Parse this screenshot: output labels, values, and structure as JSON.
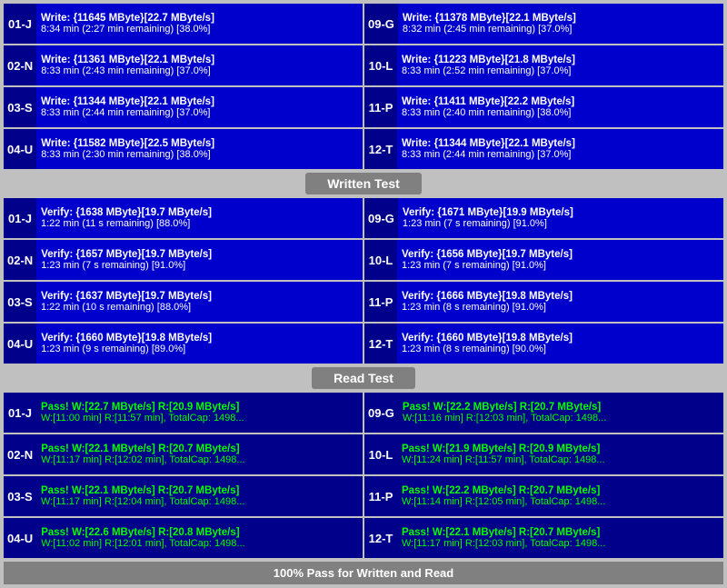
{
  "sections": {
    "write": {
      "header": "Written Test",
      "cells_left": [
        {
          "label": "01-J",
          "line1": "Write: {11645 MByte}[22.7 MByte/s]",
          "line2": "8:34 min (2:27 min remaining)  [38.0%]"
        },
        {
          "label": "02-N",
          "line1": "Write: {11361 MByte}[22.1 MByte/s]",
          "line2": "8:33 min (2:43 min remaining)  [37.0%]"
        },
        {
          "label": "03-S",
          "line1": "Write: {11344 MByte}[22.1 MByte/s]",
          "line2": "8:33 min (2:44 min remaining)  [37.0%]"
        },
        {
          "label": "04-U",
          "line1": "Write: {11582 MByte}[22.5 MByte/s]",
          "line2": "8:33 min (2:30 min remaining)  [38.0%]"
        }
      ],
      "cells_right": [
        {
          "label": "09-G",
          "line1": "Write: {11378 MByte}[22.1 MByte/s]",
          "line2": "8:32 min (2:45 min remaining)  [37.0%]"
        },
        {
          "label": "10-L",
          "line1": "Write: {11223 MByte}[21.8 MByte/s]",
          "line2": "8:33 min (2:52 min remaining)  [37.0%]"
        },
        {
          "label": "11-P",
          "line1": "Write: {11411 MByte}[22.2 MByte/s]",
          "line2": "8:33 min (2:40 min remaining)  [38.0%]"
        },
        {
          "label": "12-T",
          "line1": "Write: {11344 MByte}[22.1 MByte/s]",
          "line2": "8:33 min (2:44 min remaining)  [37.0%]"
        }
      ]
    },
    "verify": {
      "cells_left": [
        {
          "label": "01-J",
          "line1": "Verify: {1638 MByte}[19.7 MByte/s]",
          "line2": "1:22 min (11 s remaining)  [88.0%]"
        },
        {
          "label": "02-N",
          "line1": "Verify: {1657 MByte}[19.7 MByte/s]",
          "line2": "1:23 min (7 s remaining)  [91.0%]"
        },
        {
          "label": "03-S",
          "line1": "Verify: {1637 MByte}[19.7 MByte/s]",
          "line2": "1:22 min (10 s remaining)  [88.0%]"
        },
        {
          "label": "04-U",
          "line1": "Verify: {1660 MByte}[19.8 MByte/s]",
          "line2": "1:23 min (9 s remaining)  [89.0%]"
        }
      ],
      "cells_right": [
        {
          "label": "09-G",
          "line1": "Verify: {1671 MByte}[19.9 MByte/s]",
          "line2": "1:23 min (7 s remaining)  [91.0%]"
        },
        {
          "label": "10-L",
          "line1": "Verify: {1656 MByte}[19.7 MByte/s]",
          "line2": "1:23 min (7 s remaining)  [91.0%]"
        },
        {
          "label": "11-P",
          "line1": "Verify: {1666 MByte}[19.8 MByte/s]",
          "line2": "1:23 min (8 s remaining)  [91.0%]"
        },
        {
          "label": "12-T",
          "line1": "Verify: {1660 MByte}[19.8 MByte/s]",
          "line2": "1:23 min (8 s remaining)  [90.0%]"
        }
      ]
    },
    "read": {
      "header": "Read Test",
      "cells_left": [
        {
          "label": "01-J",
          "line1": "Pass! W:[22.7 MByte/s] R:[20.9 MByte/s]",
          "line2": "W:[11:00 min] R:[11:57 min], TotalCap: 1498..."
        },
        {
          "label": "02-N",
          "line1": "Pass! W:[22.1 MByte/s] R:[20.7 MByte/s]",
          "line2": "W:[11:17 min] R:[12:02 min], TotalCap: 1498..."
        },
        {
          "label": "03-S",
          "line1": "Pass! W:[22.1 MByte/s] R:[20.7 MByte/s]",
          "line2": "W:[11:17 min] R:[12:04 min], TotalCap: 1498..."
        },
        {
          "label": "04-U",
          "line1": "Pass! W:[22.6 MByte/s] R:[20.8 MByte/s]",
          "line2": "W:[11:02 min] R:[12:01 min], TotalCap: 1498..."
        }
      ],
      "cells_right": [
        {
          "label": "09-G",
          "line1": "Pass! W:[22.2 MByte/s] R:[20.7 MByte/s]",
          "line2": "W:[11:16 min] R:[12:03 min], TotalCap: 1498..."
        },
        {
          "label": "10-L",
          "line1": "Pass! W:[21.9 MByte/s] R:[20.9 MByte/s]",
          "line2": "W:[11:24 min] R:[11:57 min], TotalCap: 1498..."
        },
        {
          "label": "11-P",
          "line1": "Pass! W:[22.2 MByte/s] R:[20.7 MByte/s]",
          "line2": "W:[11:14 min] R:[12:05 min], TotalCap: 1498..."
        },
        {
          "label": "12-T",
          "line1": "Pass! W:[22.1 MByte/s] R:[20.7 MByte/s]",
          "line2": "W:[11:17 min] R:[12:03 min], TotalCap: 1498..."
        }
      ]
    }
  },
  "footer": "100% Pass for Written and Read"
}
